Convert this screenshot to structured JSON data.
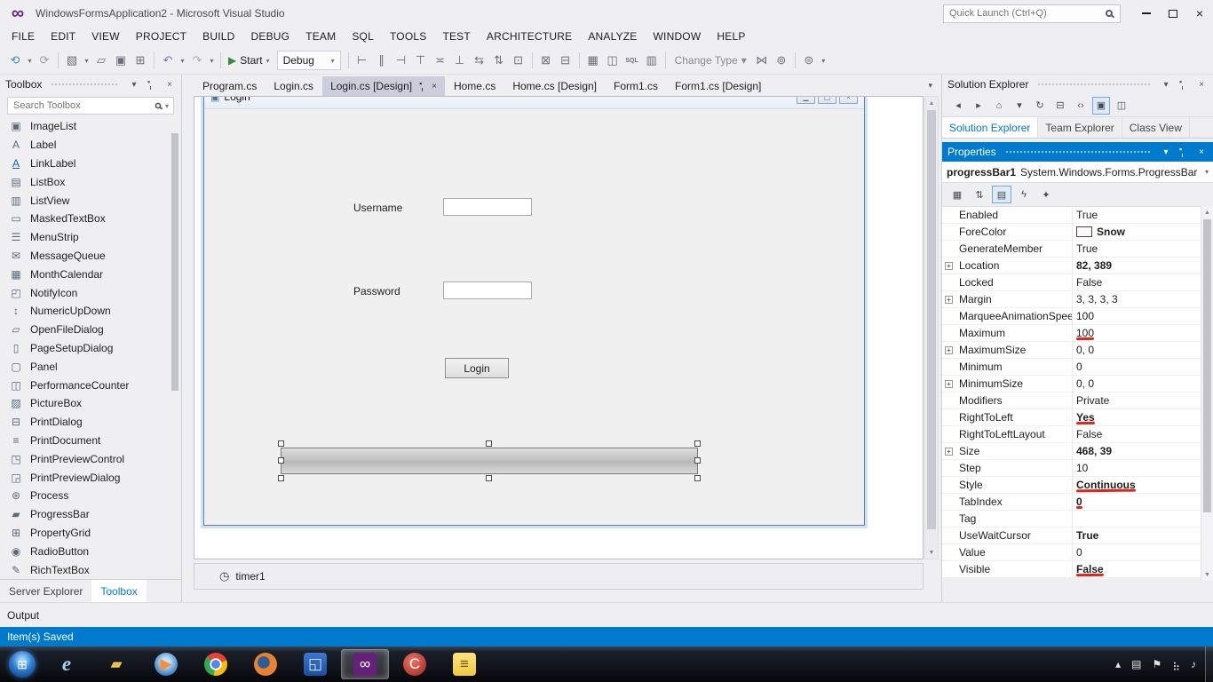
{
  "title_bar": {
    "app_title": "WindowsFormsApplication2 - Microsoft Visual Studio",
    "quick_launch_placeholder": "Quick Launch (Ctrl+Q)"
  },
  "icons": {
    "chevron_down": "▾",
    "close": "×",
    "scroll_up": "▲",
    "scroll_down": "▼",
    "timer": "◷",
    "tab_overflow": "▾"
  },
  "menu": {
    "items": [
      {
        "label": "FILE"
      },
      {
        "label": "EDIT"
      },
      {
        "label": "VIEW"
      },
      {
        "label": "PROJECT"
      },
      {
        "label": "BUILD"
      },
      {
        "label": "DEBUG"
      },
      {
        "label": "TEAM"
      },
      {
        "label": "SQL"
      },
      {
        "label": "TOOLS"
      },
      {
        "label": "TEST"
      },
      {
        "label": "ARCHITECTURE"
      },
      {
        "label": "ANALYZE"
      },
      {
        "label": "WINDOW"
      },
      {
        "label": "HELP"
      }
    ]
  },
  "toolbar": {
    "start_label": "Start",
    "debug_config": "Debug",
    "change_type_label": "Change Type",
    "items_a": [
      {
        "name": "nav-back-icon",
        "glyph": "⟲",
        "color": "#2E8FA8"
      },
      {
        "name": "nav-back-dropdown-icon",
        "glyph": "▾",
        "small": true
      },
      {
        "name": "nav-forward-icon",
        "glyph": "⟳",
        "color": "#9AA0AA"
      },
      {
        "kind": "sep"
      },
      {
        "name": "new-project-icon",
        "glyph": "▧"
      },
      {
        "name": "add-item-dropdown-icon",
        "glyph": "▾",
        "small": true
      },
      {
        "name": "open-file-icon",
        "glyph": "▱"
      },
      {
        "name": "save-icon",
        "glyph": "▣"
      },
      {
        "name": "save-all-icon",
        "glyph": "⊞"
      },
      {
        "kind": "sep"
      },
      {
        "name": "undo-icon",
        "glyph": "↶",
        "color": "#6A79C9"
      },
      {
        "name": "undo-dropdown-icon",
        "glyph": "▾",
        "small": true
      },
      {
        "name": "redo-icon",
        "glyph": "↷",
        "color": "#A9ACB4"
      },
      {
        "name": "redo-dropdown-icon",
        "glyph": "▾",
        "small": true
      },
      {
        "kind": "sep"
      }
    ],
    "items_b": [
      {
        "kind": "sep"
      },
      {
        "name": "align-lefts-icon",
        "glyph": "⊢"
      },
      {
        "name": "align-centers-icon",
        "glyph": "∥"
      },
      {
        "name": "align-rights-icon",
        "glyph": "⊣"
      },
      {
        "name": "align-tops-icon",
        "glyph": "⊤"
      },
      {
        "name": "align-middles-icon",
        "glyph": "≍"
      },
      {
        "name": "align-bottoms-icon",
        "glyph": "⊥"
      },
      {
        "name": "make-same-width-icon",
        "glyph": "⇆"
      },
      {
        "name": "make-same-height-icon",
        "glyph": "⇅"
      },
      {
        "name": "make-same-size-icon",
        "glyph": "⊡"
      },
      {
        "kind": "sep"
      },
      {
        "name": "bring-to-front-icon",
        "glyph": "⊠"
      },
      {
        "name": "send-to-back-icon",
        "glyph": "⊟"
      },
      {
        "kind": "sep"
      },
      {
        "name": "table-designer-icon",
        "glyph": "▦"
      },
      {
        "name": "database-diagram-icon",
        "glyph": "◫"
      },
      {
        "name": "sql-icon",
        "glyph": "SQL",
        "text": true
      },
      {
        "name": "schema-compare-icon",
        "glyph": "▥"
      },
      {
        "kind": "sep"
      }
    ],
    "items_c": [
      {
        "name": "relationships-icon",
        "glyph": "⋈"
      },
      {
        "name": "manage-keys-icon",
        "glyph": "⊚"
      },
      {
        "kind": "sep"
      },
      {
        "name": "manage-indexes-icon",
        "glyph": "⊜"
      },
      {
        "name": "toolbar-options-dropdown-icon",
        "glyph": "▾",
        "small": true
      }
    ]
  },
  "editor_tabs": {
    "items": [
      {
        "label": "Program.cs",
        "name": "tab-program-cs"
      },
      {
        "label": "Login.cs",
        "name": "tab-login-cs"
      },
      {
        "label": "Login.cs [Design]",
        "name": "tab-login-cs-design",
        "active": true
      },
      {
        "label": "Home.cs",
        "name": "tab-home-cs"
      },
      {
        "label": "Home.cs [Design]",
        "name": "tab-home-cs-design"
      },
      {
        "label": "Form1.cs",
        "name": "tab-form1-cs"
      },
      {
        "label": "Form1.cs [Design]",
        "name": "tab-form1-cs-design"
      }
    ]
  },
  "toolbox": {
    "title": "Toolbox",
    "search_placeholder": "Search Toolbox",
    "items": [
      {
        "label": "ImageList",
        "glyph": "▣",
        "name": "toolbox-item-imagelist"
      },
      {
        "label": "Label",
        "glyph": "A",
        "name": "toolbox-item-label"
      },
      {
        "label": "LinkLabel",
        "glyph": "A",
        "link": true,
        "name": "toolbox-item-linklabel"
      },
      {
        "label": "ListBox",
        "glyph": "▤",
        "name": "toolbox-item-listbox"
      },
      {
        "label": "ListView",
        "glyph": "▥",
        "name": "toolbox-item-listview"
      },
      {
        "label": "MaskedTextBox",
        "glyph": "▭",
        "name": "toolbox-item-maskedtextbox"
      },
      {
        "label": "MenuStrip",
        "glyph": "☰",
        "name": "toolbox-item-menustrip"
      },
      {
        "label": "MessageQueue",
        "glyph": "✉",
        "name": "toolbox-item-messagequeue"
      },
      {
        "label": "MonthCalendar",
        "glyph": "▦",
        "name": "toolbox-item-monthcalendar"
      },
      {
        "label": "NotifyIcon",
        "glyph": "◰",
        "name": "toolbox-item-notifyicon"
      },
      {
        "label": "NumericUpDown",
        "glyph": "↕",
        "name": "toolbox-item-numericupdown"
      },
      {
        "label": "OpenFileDialog",
        "glyph": "▱",
        "name": "toolbox-item-openfiledialog"
      },
      {
        "label": "PageSetupDialog",
        "glyph": "▯",
        "name": "toolbox-item-pagesetupdialog"
      },
      {
        "label": "Panel",
        "glyph": "▢",
        "name": "toolbox-item-panel"
      },
      {
        "label": "PerformanceCounter",
        "glyph": "◫",
        "name": "toolbox-item-performancecounter"
      },
      {
        "label": "PictureBox",
        "glyph": "▨",
        "name": "toolbox-item-picturebox"
      },
      {
        "label": "PrintDialog",
        "glyph": "⊟",
        "name": "toolbox-item-printdialog"
      },
      {
        "label": "PrintDocument",
        "glyph": "≡",
        "name": "toolbox-item-printdocument"
      },
      {
        "label": "PrintPreviewControl",
        "glyph": "◳",
        "name": "toolbox-item-printpreviewcontrol"
      },
      {
        "label": "PrintPreviewDialog",
        "glyph": "◲",
        "name": "toolbox-item-printpreviewdialog"
      },
      {
        "label": "Process",
        "glyph": "⊛",
        "name": "toolbox-item-process"
      },
      {
        "label": "ProgressBar",
        "glyph": "▰",
        "name": "toolbox-item-progressbar"
      },
      {
        "label": "PropertyGrid",
        "glyph": "⊞",
        "name": "toolbox-item-propertygrid"
      },
      {
        "label": "RadioButton",
        "glyph": "◉",
        "name": "toolbox-item-radiobutton"
      },
      {
        "label": "RichTextBox",
        "glyph": "✎",
        "name": "toolbox-item-richtextbox"
      }
    ]
  },
  "panel_tabs_left": {
    "items": [
      {
        "label": "Server Explorer",
        "name": "tab-server-explorer"
      },
      {
        "label": "Toolbox",
        "name": "tab-toolbox",
        "selected": true
      }
    ]
  },
  "designer": {
    "form_title": "Login",
    "username_label": "Username",
    "password_label": "Password",
    "login_button_label": "Login",
    "tray_item_label": "timer1"
  },
  "solution_explorer": {
    "title": "Solution Explorer",
    "toolbar_icons": [
      {
        "name": "back-icon",
        "glyph": "◂"
      },
      {
        "name": "forward-icon",
        "glyph": "▸"
      },
      {
        "name": "home-icon",
        "glyph": "⌂"
      },
      {
        "name": "scope-dropdown-icon",
        "glyph": "▾"
      },
      {
        "name": "refresh-icon",
        "glyph": "↻"
      },
      {
        "name": "collapse-all-icon",
        "glyph": "⊟"
      },
      {
        "name": "view-code-icon",
        "glyph": "‹›"
      },
      {
        "name": "sync-with-active-document-icon",
        "glyph": "▣",
        "selected": true
      },
      {
        "name": "preview-selected-items-icon",
        "glyph": "◫"
      }
    ],
    "tabs": [
      {
        "label": "Solution Explorer",
        "selected": true,
        "name": "tab-solution-explorer"
      },
      {
        "label": "Team Explorer",
        "name": "tab-team-explorer"
      },
      {
        "label": "Class View",
        "name": "tab-class-view"
      }
    ]
  },
  "properties": {
    "title": "Properties",
    "object_name": "progressBar1",
    "object_type": "System.Windows.Forms.ProgressBar",
    "toolbar_icons": [
      {
        "name": "categorized-icon",
        "glyph": "▦"
      },
      {
        "name": "alphabetical-icon",
        "glyph": "⇅"
      },
      {
        "name": "properties-view-icon",
        "glyph": "▤",
        "selected": true
      },
      {
        "name": "events-icon",
        "glyph": "ϟ"
      },
      {
        "name": "property-pages-icon",
        "glyph": "✦"
      }
    ],
    "rows": [
      {
        "name": "Enabled",
        "value": "True"
      },
      {
        "name": "ForeColor",
        "value": "Snow",
        "bold": true,
        "swatch": "#FFFAFA"
      },
      {
        "name": "GenerateMember",
        "value": "True"
      },
      {
        "name": "Location",
        "value": "82, 389",
        "bold": true,
        "expandable": true
      },
      {
        "name": "Locked",
        "value": "False"
      },
      {
        "name": "Margin",
        "value": "3, 3, 3, 3",
        "expandable": true
      },
      {
        "name": "MarqueeAnimationSpeed",
        "value": "100"
      },
      {
        "name": "Maximum",
        "value": "100",
        "underline": true
      },
      {
        "name": "MaximumSize",
        "value": "0, 0",
        "expandable": true
      },
      {
        "name": "Minimum",
        "value": "0"
      },
      {
        "name": "MinimumSize",
        "value": "0, 0",
        "expandable": true
      },
      {
        "name": "Modifiers",
        "value": "Private"
      },
      {
        "name": "RightToLeft",
        "value": "Yes",
        "bold": true,
        "underline": true
      },
      {
        "name": "RightToLeftLayout",
        "value": "False"
      },
      {
        "name": "Size",
        "value": "468, 39",
        "bold": true,
        "expandable": true
      },
      {
        "name": "Step",
        "value": "10"
      },
      {
        "name": "Style",
        "value": "Continuous",
        "bold": true,
        "underline": true
      },
      {
        "name": "TabIndex",
        "value": "0",
        "bold": true,
        "underline": true
      },
      {
        "name": "Tag",
        "value": ""
      },
      {
        "name": "UseWaitCursor",
        "value": "True",
        "bold": true
      },
      {
        "name": "Value",
        "value": "0"
      },
      {
        "name": "Visible",
        "value": "False",
        "bold": true,
        "underline": true
      }
    ]
  },
  "output": {
    "title": "Output"
  },
  "status_bar": {
    "message": "Item(s) Saved"
  },
  "taskbar": {
    "icons": [
      {
        "name": "start-button",
        "kind": "orb"
      },
      {
        "name": "internet-explorer-icon",
        "glyph": "e",
        "kind": "ie",
        "color": "#9ED8F8"
      },
      {
        "name": "file-explorer-icon",
        "glyph": "▰",
        "color": "#F2C14E"
      },
      {
        "name": "media-player-icon",
        "glyph": "▶",
        "color": "#FF8C2E",
        "shape": "circle",
        "bg": "radial-gradient(circle at 50% 40%, #BFE2F9 0 20%, #2F74C0 78%)"
      },
      {
        "name": "chrome-icon",
        "glyph": "",
        "shape": "circle",
        "bg": "radial-gradient(circle, #4C8BF5 0 26%, #FFFFFF 27% 36%, rgba(0,0,0,0) 37%), conic-gradient(from -50deg, #EA4335 0 120deg, #FBBC05 0 240deg, #34A853 0 360deg)"
      },
      {
        "name": "firefox-icon",
        "glyph": "",
        "shape": "circle",
        "bg": "radial-gradient(circle at 42% 42%, #2A5D9E 0 30%, #E8822C 34% 78%, #D4670F 100%)"
      },
      {
        "name": "notes-app-icon",
        "glyph": "◱",
        "color": "#DCEBFF",
        "bg": "linear-gradient(#3B78D4,#1D4E9B)"
      },
      {
        "name": "visual-studio-taskbar-icon",
        "glyph": "∞",
        "color": "#FFFFFF",
        "bg": "#68217A",
        "active": true
      },
      {
        "name": "ccleaner-icon",
        "glyph": "C",
        "color": "#FFFFFF",
        "shape": "circle",
        "bg": "radial-gradient(circle at 40% 35%, #EF7365, #9C241D)"
      },
      {
        "name": "messaging-app-icon",
        "glyph": "≡",
        "color": "#6B5B1E",
        "bg": "linear-gradient(#FCE47E,#F0C93F)"
      }
    ],
    "tray_icons": [
      {
        "name": "hidden-icons-arrow",
        "glyph": "▴"
      },
      {
        "name": "notification-icon",
        "glyph": "▤"
      },
      {
        "name": "action-center-flag-icon",
        "glyph": "⚑"
      },
      {
        "name": "network-icon",
        "glyph": "⣦"
      },
      {
        "name": "volume-icon",
        "glyph": "♪"
      }
    ]
  }
}
